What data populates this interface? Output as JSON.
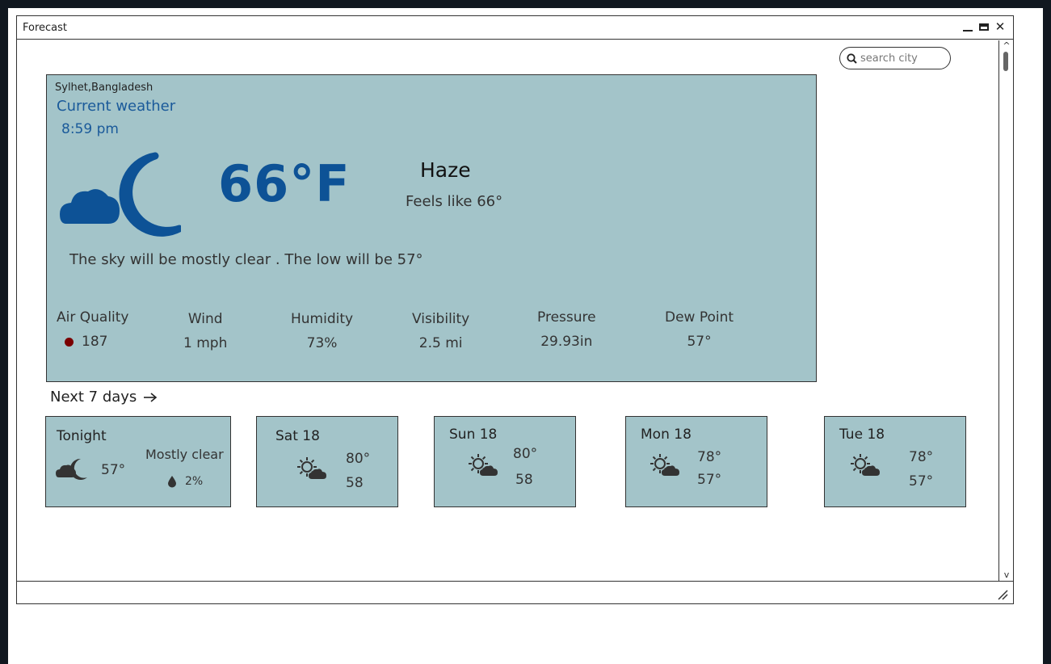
{
  "window": {
    "title": "Forecast"
  },
  "search": {
    "placeholder": "search city"
  },
  "current": {
    "location": "Sylhet,Bangladesh",
    "heading": "Current weather",
    "time": "8:59 pm",
    "temperature": "66°F",
    "condition": "Haze",
    "feels_like": "Feels like 66°",
    "summary": "The sky will be mostly clear . The low will be 57°",
    "metrics": [
      {
        "label": "Air Quality",
        "value": "187"
      },
      {
        "label": "Wind",
        "value": "1 mph"
      },
      {
        "label": "Humidity",
        "value": "73%"
      },
      {
        "label": "Visibility",
        "value": "2.5 mi"
      },
      {
        "label": "Pressure",
        "value": "29.93in"
      },
      {
        "label": "Dew Point",
        "value": "57°"
      }
    ],
    "icon": "cloud-moon-icon",
    "accent_color": "#0d5296",
    "air_quality_color": "#7a0000"
  },
  "forecast": {
    "link_label": "Next 7 days",
    "days": [
      {
        "name": "Tonight",
        "icon": "cloud-moon-icon",
        "temp": "57°",
        "description": "Mostly clear",
        "precip": "2%"
      },
      {
        "name": "Sat 18",
        "icon": "sun-cloud-icon",
        "hi": "80°",
        "lo": "58"
      },
      {
        "name": "Sun 18",
        "icon": "sun-cloud-icon",
        "hi": "80°",
        "lo": "58"
      },
      {
        "name": "Mon 18",
        "icon": "sun-cloud-icon",
        "hi": "78°",
        "lo": "57°"
      },
      {
        "name": "Tue 18",
        "icon": "sun-cloud-icon",
        "hi": "78°",
        "lo": "57°"
      }
    ]
  },
  "colors": {
    "card_bg": "#a3c4c9",
    "page_bg": "#111820"
  }
}
